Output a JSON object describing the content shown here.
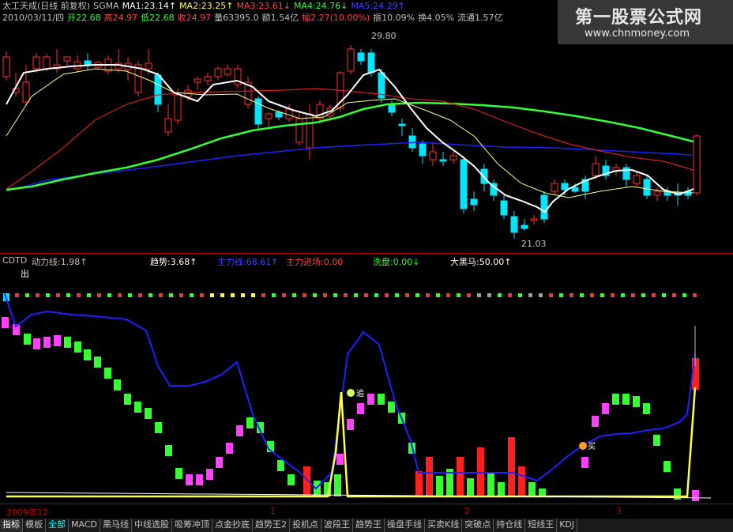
{
  "header": {
    "line1": [
      {
        "text": "太工天成(日线 前复权)",
        "color": "#c0c0c0"
      },
      {
        "text": "SGMA",
        "color": "#c0c0c0"
      },
      {
        "text": "MA1:23.14↑",
        "color": "#ffffff"
      },
      {
        "text": "MA2:23.25↑",
        "color": "#ffff66"
      },
      {
        "text": "MA3:23.61↓",
        "color": "#ff4040"
      },
      {
        "text": "MA4:24.76↓",
        "color": "#33ff33"
      },
      {
        "text": "MA5:24.29↑",
        "color": "#4040ff"
      }
    ],
    "line2": [
      {
        "text": "2010/03/11/四",
        "color": "#c0c0c0"
      },
      {
        "text": "开22.68",
        "color": "#33ff33"
      },
      {
        "text": "高24.97",
        "color": "#ff4040"
      },
      {
        "text": "低22.68",
        "color": "#33ff33"
      },
      {
        "text": "收24.97",
        "color": "#ff4040"
      },
      {
        "text": "量63395.0",
        "color": "#c0c0c0"
      },
      {
        "text": "额1.54亿",
        "color": "#c0c0c0"
      },
      {
        "text": "幅2.27(10.00%)",
        "color": "#ff4040"
      },
      {
        "text": "振10.09%",
        "color": "#c0c0c0"
      },
      {
        "text": "换4.05%",
        "color": "#c0c0c0"
      },
      {
        "text": "流通1.57亿",
        "color": "#c0c0c0"
      }
    ]
  },
  "watermark": {
    "title": "第一股票公式网",
    "url": "www.chnmoney.com"
  },
  "price_labels": {
    "high": "29.80",
    "low": "21.03"
  },
  "indicator": {
    "items": [
      {
        "text": "CDTD",
        "color": "#c0c0c0"
      },
      {
        "text": "动力线:1.98↑",
        "color": "#c0c0c0"
      },
      {
        "text": "趋势:3.68↑",
        "color": "#ffffff"
      },
      {
        "text": "主力线:68.61↑",
        "color": "#4040ff"
      },
      {
        "text": "主力进场:0.00",
        "color": "#ff4040"
      },
      {
        "text": "洗盘:0.00↓",
        "color": "#33ff33"
      },
      {
        "text": "大黑马:50.00↑",
        "color": "#ffffff"
      }
    ],
    "signal_chu": "出",
    "signal_zhui": "追",
    "signal_mai": "买"
  },
  "timeaxis": [
    "2009年12",
    "1",
    "2",
    "3"
  ],
  "tabs": [
    "指标",
    "模板",
    "全部",
    "MACD",
    "黑马线",
    "中线选股",
    "吸筹冲顶",
    "点金抄底",
    "趋势王2",
    "投机点",
    "波段王",
    "趋势王",
    "操盘手线",
    "买卖K线",
    "突破点",
    "持仓线",
    "短线王",
    "KDJ"
  ]
}
